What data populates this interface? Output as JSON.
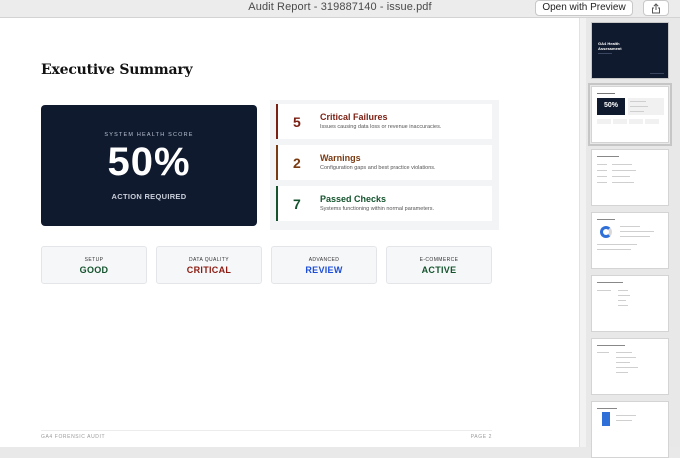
{
  "window": {
    "title": "Audit Report - 319887140 - issue.pdf",
    "open_with_label": "Open with Preview",
    "share_icon": "share-icon"
  },
  "page": {
    "heading": "Executive Summary",
    "score": {
      "label": "SYSTEM HEALTH SCORE",
      "value": "50%",
      "status": "ACTION REQUIRED"
    },
    "stats": [
      {
        "number": "5",
        "title": "Critical Failures",
        "description": "Issues causing data loss or revenue inaccuracies.",
        "color": "#7a1f12"
      },
      {
        "number": "2",
        "title": "Warnings",
        "description": "Configuration gaps and best practice violations.",
        "color": "#7a3a12"
      },
      {
        "number": "7",
        "title": "Passed Checks",
        "description": "Systems functioning within normal parameters.",
        "color": "#14532d"
      }
    ],
    "categories": [
      {
        "label": "SETUP",
        "value": "GOOD",
        "color": "#14532d"
      },
      {
        "label": "DATA QUALITY",
        "value": "CRITICAL",
        "color": "#8b1a10"
      },
      {
        "label": "ADVANCED",
        "value": "REVIEW",
        "color": "#1d4ed8"
      },
      {
        "label": "E-COMMERCE",
        "value": "ACTIVE",
        "color": "#14532d"
      }
    ],
    "footer_left": "GA4 FORENSIC AUDIT",
    "footer_right": "PAGE 2"
  },
  "sidebar": {
    "cover_title": "GA4 Health Assessment",
    "thumb_score": "50%"
  }
}
